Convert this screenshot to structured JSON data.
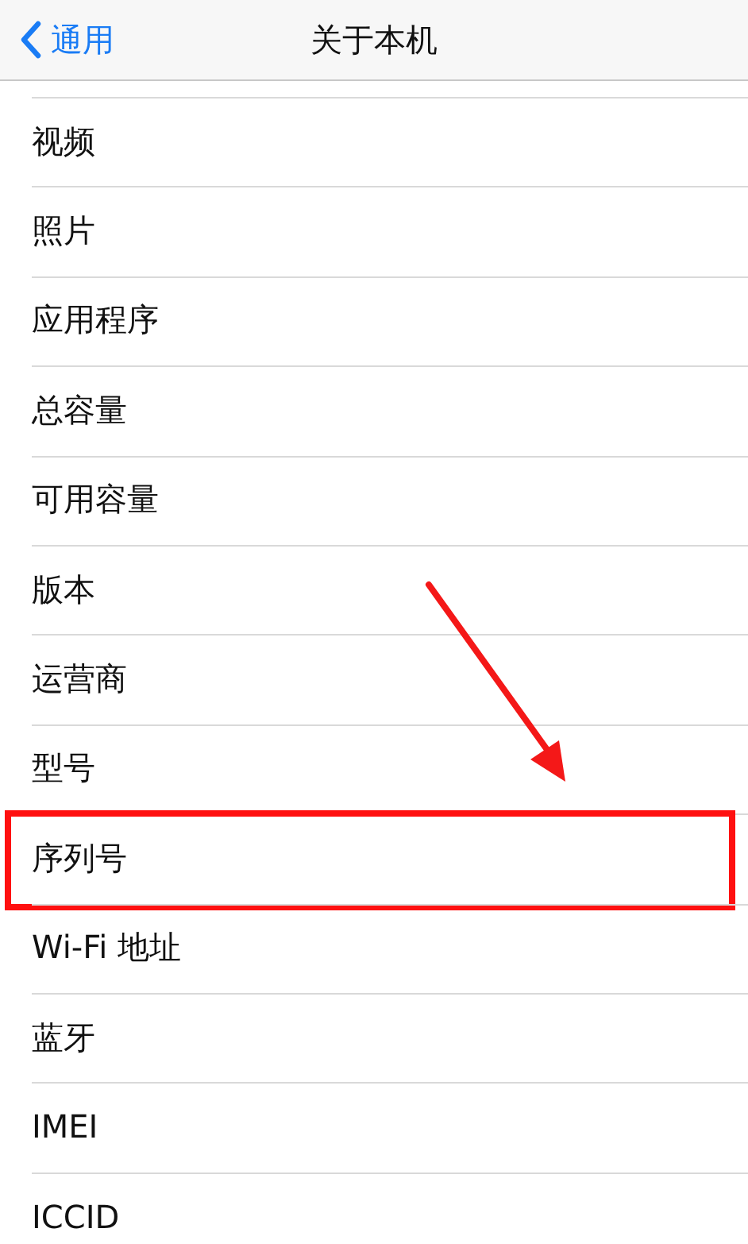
{
  "nav_bar": {
    "back": "通用",
    "title": "关于本机"
  },
  "items": [
    {
      "label": "视频",
      "highlighted": false
    },
    {
      "label": "照片",
      "highlighted": false
    },
    {
      "label": "应用程序",
      "highlighted": false
    },
    {
      "label": "总容量",
      "highlighted": false
    },
    {
      "label": "可用容量",
      "highlighted": false
    },
    {
      "label": "版本",
      "highlighted": false
    },
    {
      "label": "运营商",
      "highlighted": false
    },
    {
      "label": "型号",
      "highlighted": false
    },
    {
      "label": "序列号",
      "highlighted": true
    },
    {
      "label": "Wi-Fi 地址",
      "highlighted": false
    },
    {
      "label": "蓝牙",
      "highlighted": false
    },
    {
      "label": "IMEI",
      "highlighted": false
    },
    {
      "label": "ICCID",
      "highlighted": false
    }
  ]
}
